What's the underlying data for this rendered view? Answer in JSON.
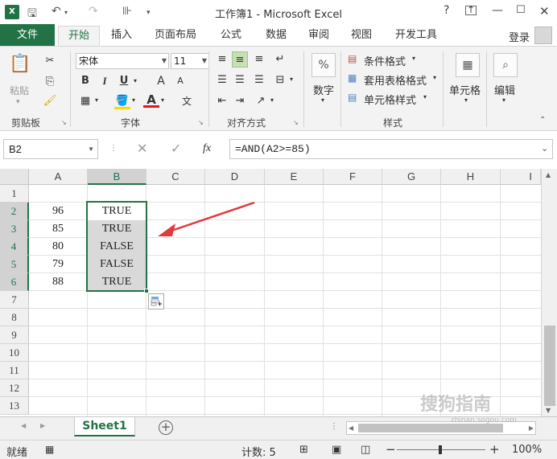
{
  "app": {
    "title": "工作簿1 - Microsoft Excel",
    "logo": "X",
    "help": "?",
    "window_controls": [
      "ribbon-display",
      "minimize",
      "maximize",
      "close"
    ]
  },
  "tabs": {
    "file": "文件",
    "items": [
      "开始",
      "插入",
      "页面布局",
      "公式",
      "数据",
      "审阅",
      "视图",
      "开发工具"
    ],
    "active": "开始",
    "login": "登录"
  },
  "ribbon": {
    "clipboard": {
      "label": "剪贴板",
      "paste": "粘贴"
    },
    "font": {
      "label": "字体",
      "name": "宋体",
      "size": "11",
      "bold": "B",
      "italic": "I",
      "underline": "U",
      "grow": "A",
      "shrink": "A",
      "color_letter": "A",
      "phonetic": "文"
    },
    "alignment": {
      "label": "对齐方式"
    },
    "number": {
      "label": "数字",
      "icon": "%"
    },
    "styles": {
      "label": "样式",
      "conditional": "条件格式",
      "table": "套用表格格式",
      "cell_styles": "单元格样式"
    },
    "cells": {
      "label": "单元格"
    },
    "editing": {
      "label": "编辑"
    }
  },
  "formula_bar": {
    "name_box": "B2",
    "fx": "fx",
    "formula": "=AND(A2>=85)"
  },
  "grid": {
    "columns": [
      "A",
      "B",
      "C",
      "D",
      "E",
      "F",
      "G",
      "H",
      "I"
    ],
    "selected_column": "B",
    "rows": [
      "1",
      "2",
      "3",
      "4",
      "5",
      "6",
      "7",
      "8",
      "9",
      "10",
      "11",
      "12",
      "13"
    ],
    "selected_rows": [
      "2",
      "3",
      "4",
      "5",
      "6"
    ],
    "cells": [
      {
        "ref": "A2",
        "value": "96"
      },
      {
        "ref": "B2",
        "value": "TRUE"
      },
      {
        "ref": "A3",
        "value": "85"
      },
      {
        "ref": "B3",
        "value": "TRUE"
      },
      {
        "ref": "A4",
        "value": "80"
      },
      {
        "ref": "B4",
        "value": "FALSE"
      },
      {
        "ref": "A5",
        "value": "79"
      },
      {
        "ref": "B5",
        "value": "FALSE"
      },
      {
        "ref": "A6",
        "value": "88"
      },
      {
        "ref": "B6",
        "value": "TRUE"
      }
    ],
    "selection": "B2:B6",
    "accent_color": "#217346",
    "arrow_color": "#e03a3a"
  },
  "sheets": {
    "items": [
      "Sheet1"
    ],
    "active": "Sheet1",
    "add": "+"
  },
  "status": {
    "ready": "就绪",
    "count": "计数: 5",
    "zoom": "100%",
    "zoom_minus": "−",
    "zoom_plus": "+"
  },
  "watermark": {
    "brand": "搜狗指南",
    "url": "zhinan.sogou.com"
  }
}
